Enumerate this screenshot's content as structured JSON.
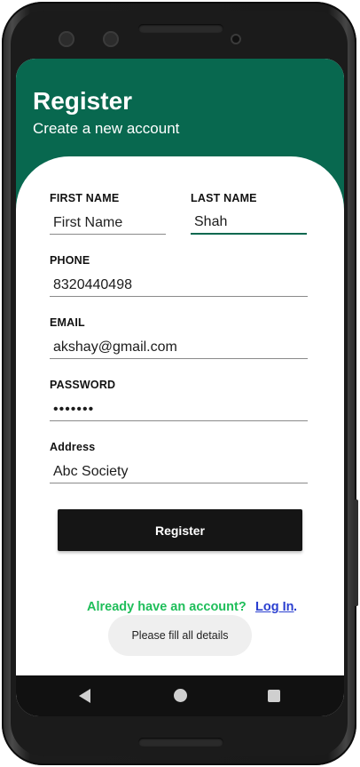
{
  "header": {
    "title": "Register",
    "subtitle": "Create a new account",
    "color": "#08684f"
  },
  "form": {
    "first_name": {
      "label": "FIRST NAME",
      "value": "",
      "placeholder": "First Name"
    },
    "last_name": {
      "label": "LAST NAME",
      "value": "Shah"
    },
    "phone": {
      "label": "PHONE",
      "value": "8320440498"
    },
    "email": {
      "label": "EMAIL",
      "value": "akshay@gmail.com"
    },
    "password": {
      "label": "PASSWORD",
      "value": "•••••••"
    },
    "address": {
      "label": "Address",
      "value": "Abc Society"
    },
    "submit_label": "Register"
  },
  "footer": {
    "prompt": "Already have an account?",
    "login_link": "Log In",
    "login_suffix": "."
  },
  "toast": "Please fill all details",
  "navbar": {
    "icons": [
      "back-icon",
      "home-icon",
      "recents-icon"
    ]
  },
  "colors": {
    "accent": "#08684f",
    "button": "#151515",
    "prompt_green": "#1fbe5a",
    "link_blue": "#2a3fd0"
  }
}
